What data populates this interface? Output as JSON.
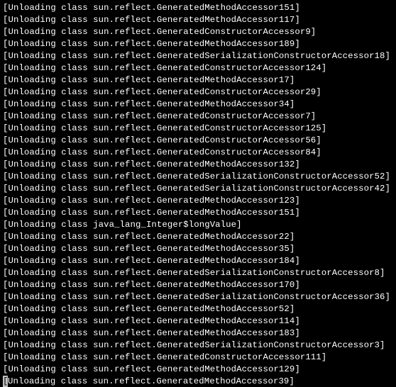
{
  "terminal": {
    "lines": [
      "[Unloading class sun.reflect.GeneratedMethodAccessor151]",
      "[Unloading class sun.reflect.GeneratedMethodAccessor117]",
      "[Unloading class sun.reflect.GeneratedConstructorAccessor9]",
      "[Unloading class sun.reflect.GeneratedMethodAccessor189]",
      "[Unloading class sun.reflect.GeneratedSerializationConstructorAccessor18]",
      "[Unloading class sun.reflect.GeneratedConstructorAccessor124]",
      "[Unloading class sun.reflect.GeneratedMethodAccessor17]",
      "[Unloading class sun.reflect.GeneratedConstructorAccessor29]",
      "[Unloading class sun.reflect.GeneratedMethodAccessor34]",
      "[Unloading class sun.reflect.GeneratedConstructorAccessor7]",
      "[Unloading class sun.reflect.GeneratedConstructorAccessor125]",
      "[Unloading class sun.reflect.GeneratedConstructorAccessor56]",
      "[Unloading class sun.reflect.GeneratedConstructorAccessor84]",
      "[Unloading class sun.reflect.GeneratedMethodAccessor132]",
      "[Unloading class sun.reflect.GeneratedSerializationConstructorAccessor52]",
      "[Unloading class sun.reflect.GeneratedSerializationConstructorAccessor42]",
      "[Unloading class sun.reflect.GeneratedMethodAccessor123]",
      "[Unloading class sun.reflect.GeneratedMethodAccessor151]",
      "[Unloading class java_lang_Integer$longValue]",
      "[Unloading class sun.reflect.GeneratedMethodAccessor22]",
      "[Unloading class sun.reflect.GeneratedMethodAccessor35]",
      "[Unloading class sun.reflect.GeneratedMethodAccessor184]",
      "[Unloading class sun.reflect.GeneratedSerializationConstructorAccessor8]",
      "[Unloading class sun.reflect.GeneratedMethodAccessor170]",
      "[Unloading class sun.reflect.GeneratedSerializationConstructorAccessor36]",
      "[Unloading class sun.reflect.GeneratedMethodAccessor52]",
      "[Unloading class sun.reflect.GeneratedMethodAccessor114]",
      "[Unloading class sun.reflect.GeneratedMethodAccessor183]",
      "[Unloading class sun.reflect.GeneratedSerializationConstructorAccessor3]",
      "[Unloading class sun.reflect.GeneratedConstructorAccessor111]",
      "[Unloading class sun.reflect.GeneratedMethodAccessor129]"
    ],
    "cursor_line_text": "Unloading class sun.reflect.GeneratedMethodAccessor39]",
    "cursor_char": "["
  }
}
